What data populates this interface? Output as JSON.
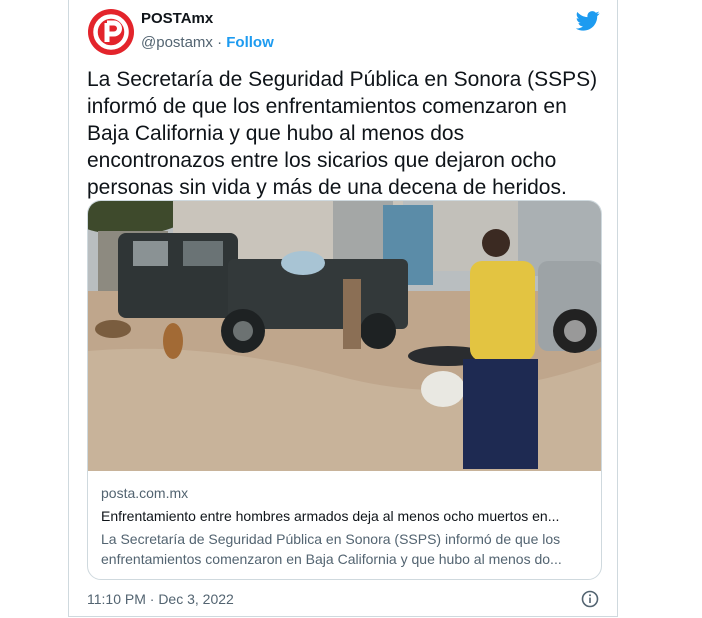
{
  "account": {
    "display_name": "POSTAmx",
    "handle": "@postamx",
    "separator": "·",
    "follow_label": "Follow",
    "brand_color": "#e3242b"
  },
  "tweet": {
    "text": "La Secretaría de Seguridad Pública en Sonora (SSPS) informó de que los enfrentamientos comenzaron en Baja California y que hubo al menos dos encontronazos entre los sicarios que dejaron ocho personas sin vida y más de una decena de heridos.",
    "timestamp": "11:10 PM · Dec 3, 2022"
  },
  "link_card": {
    "domain": "posta.com.mx",
    "title": "Enfrentamiento entre hombres armados deja al menos ocho muertos en...",
    "description_line1": "La Secretaría de Seguridad Pública en Sonora (SSPS) informó de que los",
    "description_line2": "enfrentamientos comenzaron en Baja California y que hubo al menos do..."
  },
  "icons": {
    "platform": "twitter-bird-icon",
    "info": "info-icon",
    "avatar": "posta-logo"
  },
  "colors": {
    "accent": "#1d9bf0",
    "secondary_text": "#536471",
    "border": "#cfd9de"
  }
}
